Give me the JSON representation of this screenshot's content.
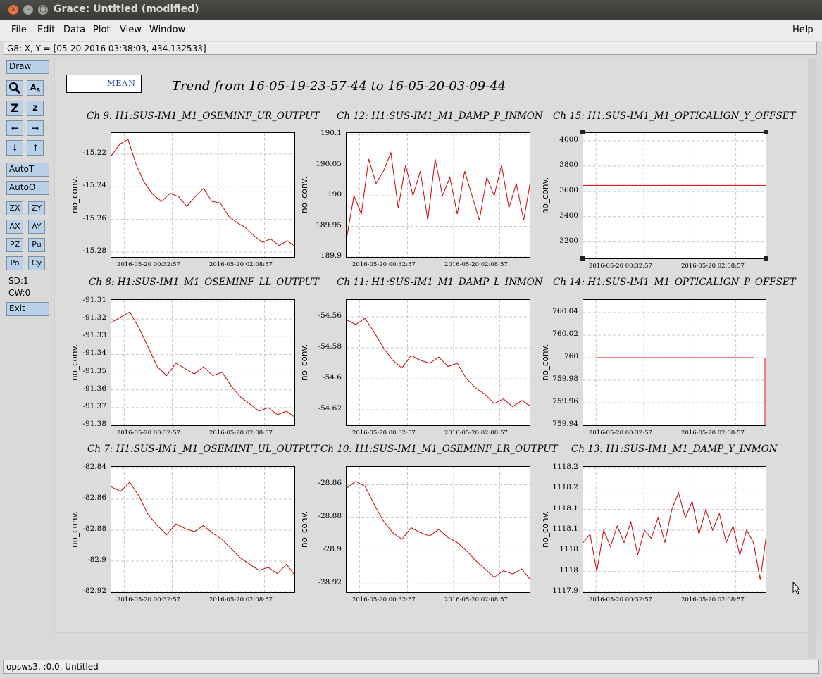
{
  "window": {
    "title": "Grace: Untitled (modified)",
    "controls": [
      "close-icon",
      "minimize-icon",
      "maximize-icon"
    ]
  },
  "menubar": {
    "items": [
      "File",
      "Edit",
      "Data",
      "Plot",
      "View",
      "Window"
    ],
    "help": "Help"
  },
  "locator": "G8: X, Y = [05-20-2016 03:38:03, 434.132533]",
  "toolbar": {
    "draw": "Draw",
    "zoom_icon": "magnifier-icon",
    "autotick_icon": "autoscale-text-icon",
    "zoom_in": "Z",
    "zoom_out": "z",
    "left": "←",
    "right": "→",
    "down": "↓",
    "up": "↑",
    "autot": "AutoT",
    "autoo": "AutoO",
    "zx": "ZX",
    "zy": "ZY",
    "ax": "AX",
    "ay": "AY",
    "pz": "PZ",
    "pu": "Pu",
    "po": "Po",
    "cy": "Cy",
    "sd": "SD:1",
    "cw": "CW:0",
    "exit": "Exit"
  },
  "legend": {
    "label": "MEAN",
    "color": "#d00000"
  },
  "main_title": "Trend from 16-05-19-23-57-44 to 16-05-20-03-09-44",
  "statusbar": "opsws3, :0.0, Untitled",
  "colors": {
    "trace": "#d00000",
    "grid": "#c8c8c8",
    "button": "#b8d0e8"
  },
  "chart_data": [
    {
      "type": "line",
      "title": "Ch 9: H1:SUS-IM1_M1_OSEMINF_UR_OUTPUT",
      "ylabel": "no_conv.",
      "ylim": [
        -15.283,
        -15.208
      ],
      "yticks": [
        "-15.22",
        "-15.24",
        "-15.26",
        "-15.28"
      ],
      "ytick_values": [
        -15.22,
        -15.24,
        -15.26,
        -15.28
      ],
      "xticks": [
        "2016-05-20 00:32:57",
        "2016-05-20 02:08:57"
      ],
      "series": [
        {
          "values": [
            -15.221,
            -15.214,
            -15.211,
            -15.227,
            -15.238,
            -15.245,
            -15.249,
            -15.244,
            -15.246,
            -15.252,
            -15.246,
            -15.241,
            -15.249,
            -15.25,
            -15.258,
            -15.262,
            -15.265,
            -15.27,
            -15.274,
            -15.272,
            -15.276,
            -15.273,
            -15.277
          ]
        }
      ]
    },
    {
      "type": "line",
      "title": "Ch 12: H1:SUS-IM1_M1_DAMP_P_INMON",
      "ylabel": "no_conv.",
      "ylim": [
        189.9,
        190.1
      ],
      "yticks": [
        "190.1",
        "190.05",
        "190",
        "189.95",
        "189.9"
      ],
      "ytick_values": [
        190.1,
        190.05,
        190.0,
        189.95,
        189.9
      ],
      "xticks": [
        "2016-05-20 00:32:57",
        "2016-05-20 02:08:57"
      ],
      "series": [
        {
          "values": [
            189.93,
            190.0,
            189.97,
            190.06,
            190.02,
            190.04,
            190.07,
            189.98,
            190.05,
            190.0,
            190.04,
            189.96,
            190.06,
            190.0,
            190.03,
            189.97,
            190.04,
            190.0,
            189.96,
            190.03,
            190.0,
            190.05,
            189.98,
            190.02,
            189.96,
            190.03
          ]
        }
      ]
    },
    {
      "type": "line",
      "title": "Ch 15: H1:SUS-IM1_M1_OPTICALIGN_Y_OFFSET",
      "ylabel": "no_conv.",
      "ylim": [
        3070,
        4050
      ],
      "yticks": [
        "4000",
        "3800",
        "3600",
        "3400",
        "3200"
      ],
      "ytick_values": [
        4000,
        3800,
        3600,
        3400,
        3200
      ],
      "xticks": [
        "2016-05-20 00:32:57",
        "2016-05-20 02:08:57"
      ],
      "series": [
        {
          "values": [
            3647,
            3647
          ]
        }
      ]
    },
    {
      "type": "line",
      "title": "Ch 8: H1:SUS-IM1_M1_OSEMINF_LL_OUTPUT",
      "ylabel": "no_conv.",
      "ylim": [
        -91.38,
        -91.31
      ],
      "yticks": [
        "-91.31",
        "-91.32",
        "-91.33",
        "-91.34",
        "-91.35",
        "-91.36",
        "-91.37",
        "-91.38"
      ],
      "ytick_values": [
        -91.31,
        -91.32,
        -91.33,
        -91.34,
        -91.35,
        -91.36,
        -91.37,
        -91.38
      ],
      "xticks": [
        "2016-05-20 00:32:57",
        "2016-05-20 02:08:57"
      ],
      "series": [
        {
          "values": [
            -91.322,
            -91.319,
            -91.316,
            -91.325,
            -91.336,
            -91.347,
            -91.352,
            -91.345,
            -91.348,
            -91.351,
            -91.347,
            -91.352,
            -91.35,
            -91.358,
            -91.364,
            -91.368,
            -91.372,
            -91.37,
            -91.374,
            -91.372,
            -91.376
          ]
        }
      ]
    },
    {
      "type": "line",
      "title": "Ch 11: H1:SUS-IM1_M1_DAMP_L_INMON",
      "ylabel": "no_conv.",
      "ylim": [
        -54.63,
        -54.55
      ],
      "yticks": [
        "-54.56",
        "-54.58",
        "-54.6",
        "-54.62"
      ],
      "ytick_values": [
        -54.56,
        -54.58,
        -54.6,
        -54.62
      ],
      "xticks": [
        "2016-05-20 00:32:57",
        "2016-05-20 02:08:57"
      ],
      "series": [
        {
          "values": [
            -54.562,
            -54.565,
            -54.561,
            -54.57,
            -54.58,
            -54.588,
            -54.593,
            -54.585,
            -54.588,
            -54.59,
            -54.586,
            -54.592,
            -54.59,
            -54.6,
            -54.606,
            -54.61,
            -54.616,
            -54.613,
            -54.618,
            -54.614,
            -54.618
          ]
        }
      ]
    },
    {
      "type": "line",
      "title": "Ch 14: H1:SUS-IM1_M1_OPTICALIGN_P_OFFSET",
      "ylabel": "no_conv.",
      "ylim": [
        759.94,
        760.05
      ],
      "yticks": [
        "760.04",
        "760.02",
        "760",
        "759.98",
        "759.96",
        "759.94"
      ],
      "ytick_values": [
        760.04,
        760.02,
        760.0,
        759.98,
        759.96,
        759.94
      ],
      "xticks": [
        "2016-05-20 00:32:57",
        "2016-05-20 02:08:57"
      ],
      "series": [
        {
          "values": [
            760.0,
            760.0
          ]
        }
      ]
    },
    {
      "type": "line",
      "title": "Ch 7: H1:SUS-IM1_M1_OSEMINF_UL_OUTPUT",
      "ylabel": "no_conv.",
      "ylim": [
        -82.92,
        -82.84
      ],
      "yticks": [
        "-82.84",
        "-82.86",
        "-82.88",
        "-82.9",
        "-82.92"
      ],
      "ytick_values": [
        -82.84,
        -82.86,
        -82.88,
        -82.9,
        -82.92
      ],
      "xticks": [
        "2016-05-20 00:32:57",
        "2016-05-20 02:08:57"
      ],
      "series": [
        {
          "values": [
            -82.852,
            -82.855,
            -82.849,
            -82.858,
            -82.87,
            -82.877,
            -82.883,
            -82.876,
            -82.879,
            -82.881,
            -82.877,
            -82.882,
            -82.886,
            -82.892,
            -82.898,
            -82.902,
            -82.906,
            -82.904,
            -82.908,
            -82.902,
            -82.91
          ]
        }
      ]
    },
    {
      "type": "line",
      "title": "Ch 10: H1:SUS-IM1_M1_OSEMINF_LR_OUTPUT",
      "ylabel": "no_conv.",
      "ylim": [
        -28.925,
        -28.85
      ],
      "yticks": [
        "-28.86",
        "-28.88",
        "-28.9",
        "-28.92"
      ],
      "ytick_values": [
        -28.86,
        -28.88,
        -28.9,
        -28.92
      ],
      "xticks": [
        "2016-05-20 00:32:57",
        "2016-05-20 02:08:57"
      ],
      "series": [
        {
          "values": [
            -28.862,
            -28.858,
            -28.861,
            -28.872,
            -28.882,
            -28.889,
            -28.893,
            -28.886,
            -28.889,
            -28.891,
            -28.887,
            -28.892,
            -28.895,
            -28.9,
            -28.906,
            -28.911,
            -28.916,
            -28.912,
            -28.914,
            -28.911,
            -28.918
          ]
        }
      ]
    },
    {
      "type": "line",
      "title": "Ch 13: H1:SUS-IM1_M1_DAMP_Y_INMON",
      "ylabel": "no_conv.",
      "ylim": [
        1117.9,
        1118.2
      ],
      "yticks": [
        "1118.2",
        "1118.2",
        "1118.1",
        "1118.1",
        "1118",
        "1118",
        "1117.9"
      ],
      "ytick_values": [
        1118.2,
        1118.15,
        1118.1,
        1118.05,
        1118.0,
        1117.95,
        1117.9
      ],
      "xticks": [
        "2016-05-20 00:32:57",
        "2016-05-20 02:08:57"
      ],
      "series": [
        {
          "values": [
            1118.02,
            1118.04,
            1117.95,
            1118.05,
            1118.01,
            1118.06,
            1118.02,
            1118.07,
            1117.99,
            1118.05,
            1118.03,
            1118.08,
            1118.02,
            1118.1,
            1118.14,
            1118.08,
            1118.12,
            1118.04,
            1118.1,
            1118.05,
            1118.09,
            1118.02,
            1118.06,
            1117.99,
            1118.05,
            1118.02,
            1117.93,
            1118.05
          ]
        }
      ]
    }
  ]
}
